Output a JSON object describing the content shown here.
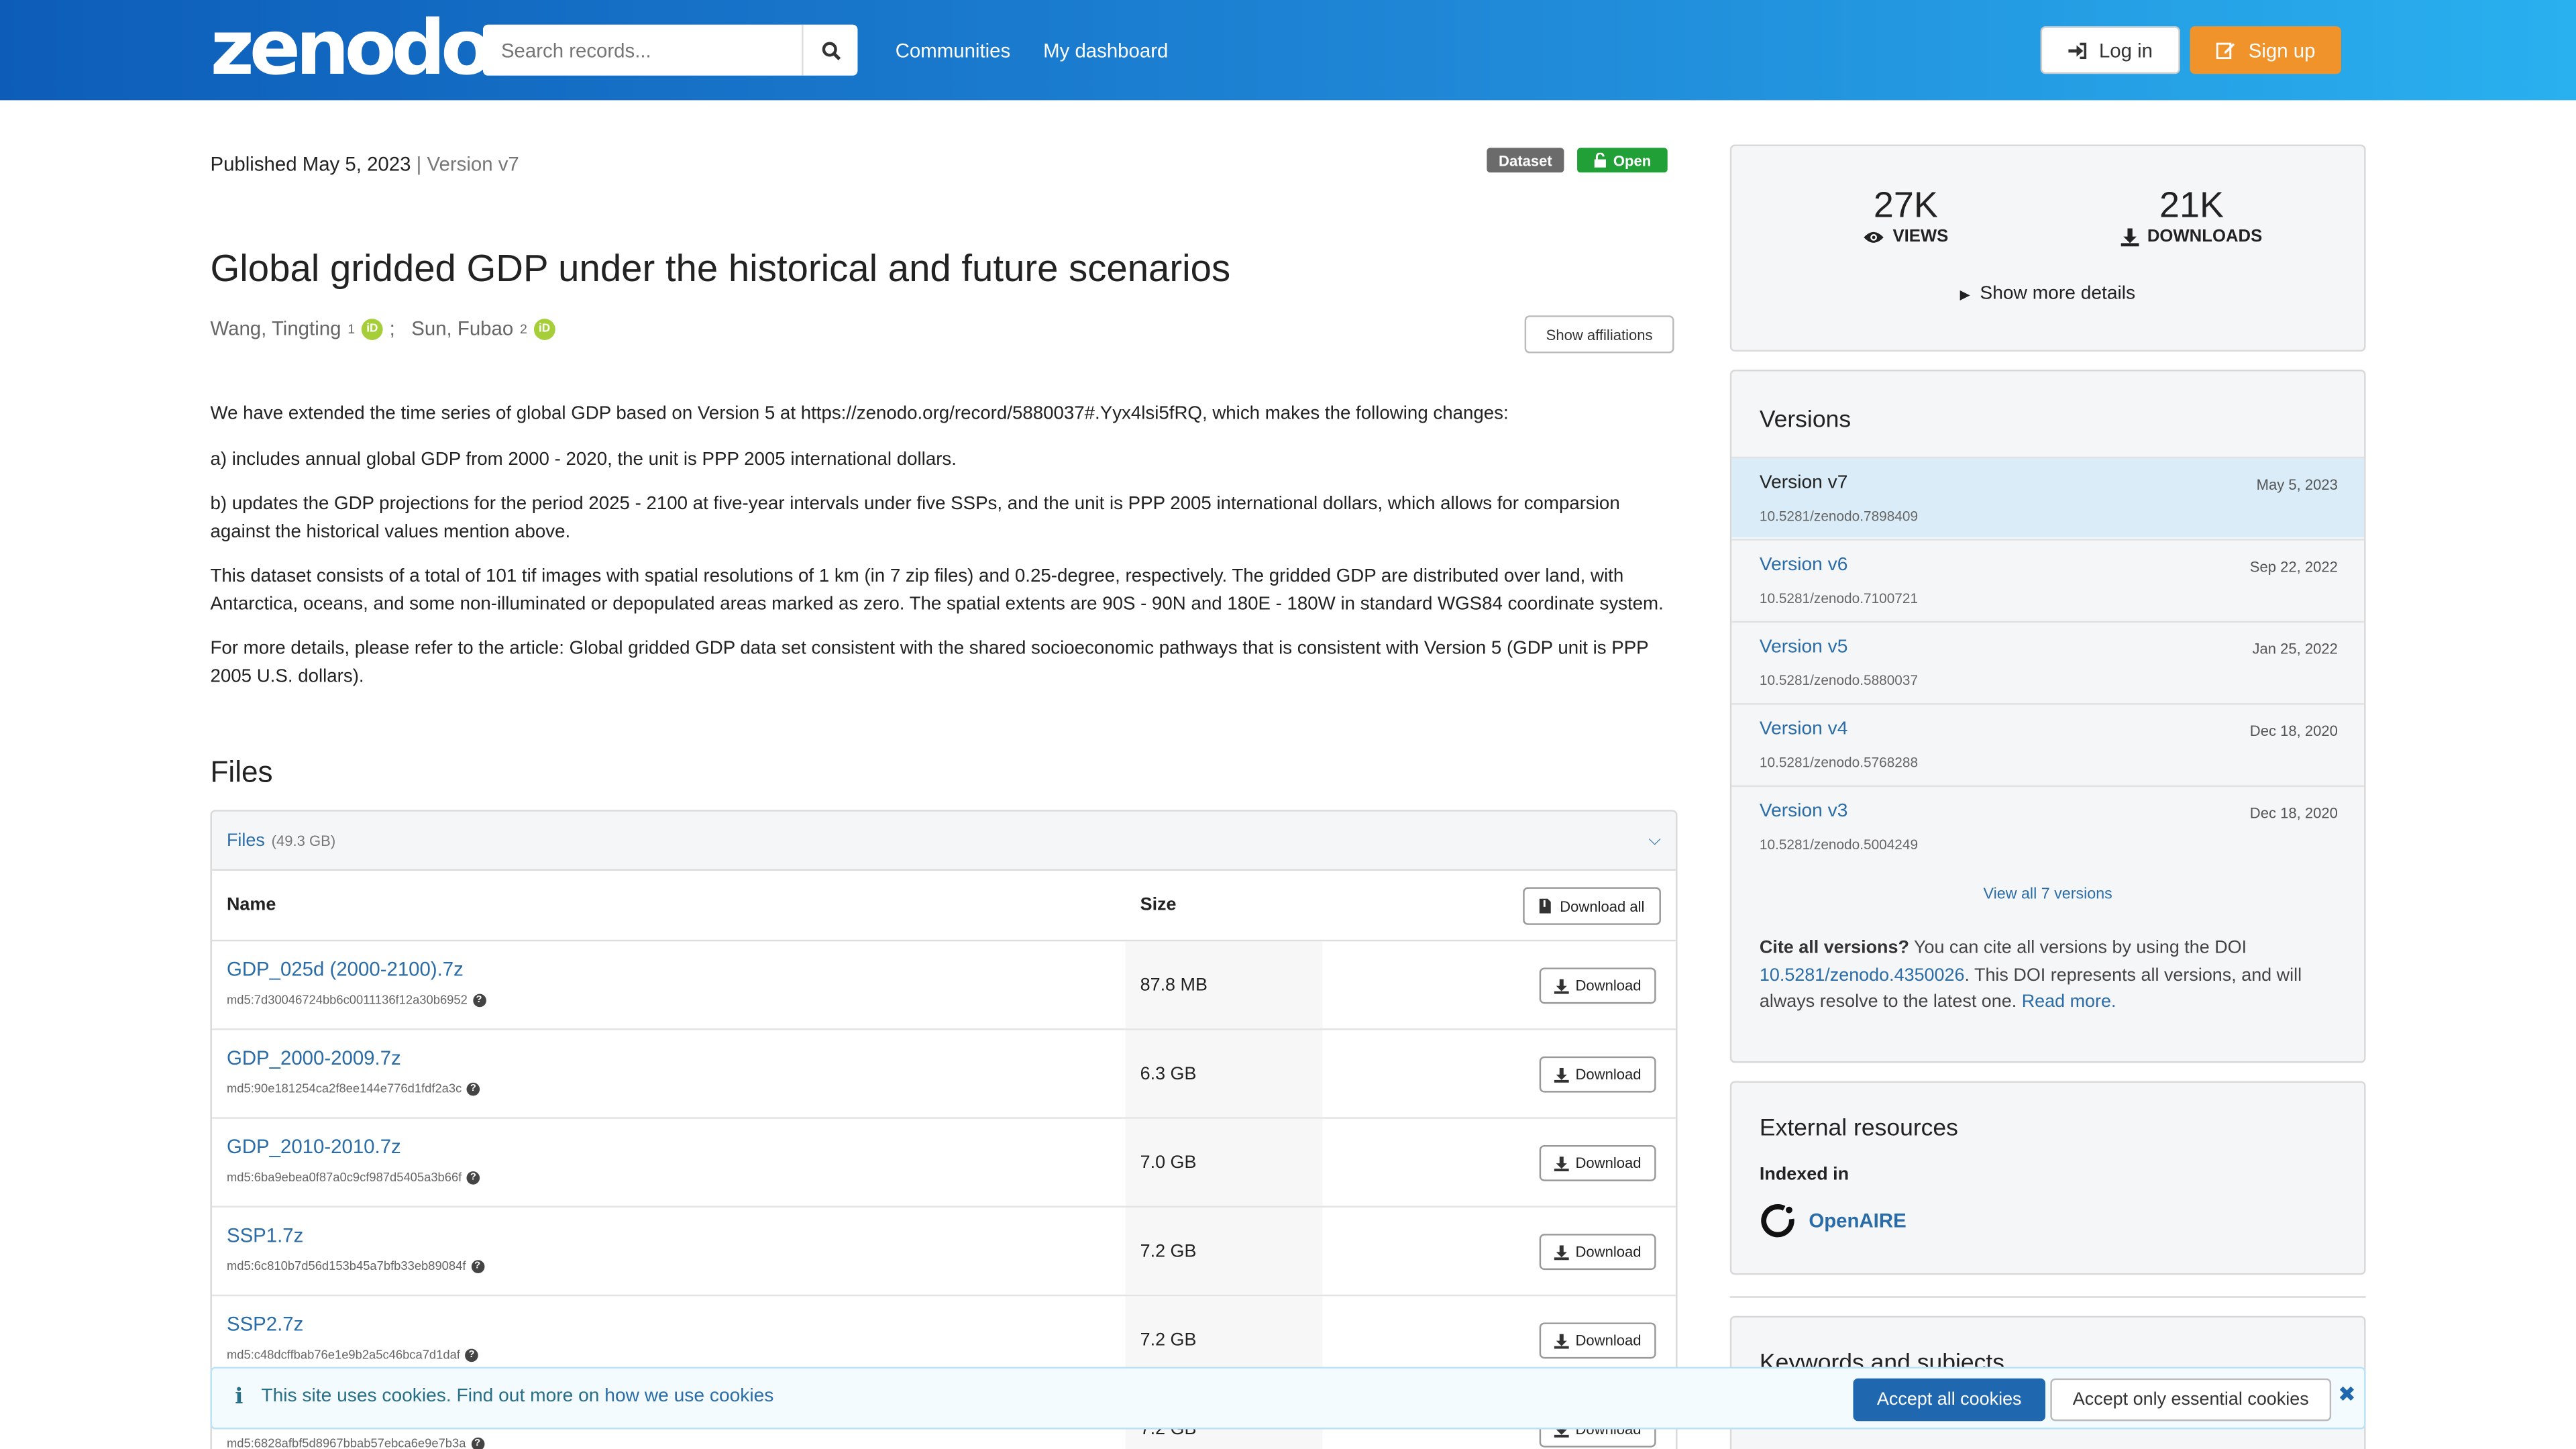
{
  "header": {
    "logo": "zenodo",
    "search_placeholder": "Search records...",
    "nav": [
      "Communities",
      "My dashboard"
    ],
    "login_label": "Log in",
    "signup_label": "Sign up"
  },
  "record": {
    "published": "Published May 5, 2023",
    "version_sep": "|",
    "version": "Version v7",
    "badges": {
      "type": "Dataset",
      "access": "Open"
    },
    "title": "Global gridded GDP under the historical and future scenarios",
    "authors": [
      {
        "name": "Wang, Tingting",
        "sup": "1",
        "sep": ";"
      },
      {
        "name": "Sun, Fubao",
        "sup": "2",
        "sep": ""
      }
    ],
    "show_affiliations": "Show affiliations",
    "description": [
      "We have extended the time series of global GDP based on Version 5 at https://zenodo.org/record/5880037#.Yyx4lsi5fRQ, which makes the following changes:",
      "a) includes annual global GDP from 2000 - 2020, the unit is PPP 2005 international dollars.",
      "b) updates the GDP projections for the period 2025 - 2100 at five-year intervals under five SSPs, and the unit is PPP 2005 international dollars, which allows for comparsion against the historical values mention above.",
      "This dataset consists of a total of 101 tif images with spatial resolutions of 1 km (in 7 zip files) and 0.25-degree, respectively. The gridded GDP are distributed over land, with Antarctica, oceans, and some non-illuminated or depopulated areas marked as zero. The spatial extents are 90S - 90N and 180E - 180W in standard WGS84 coordinate system.",
      "For more details, please refer to the article: Global gridded GDP data set consistent with the shared socioeconomic pathways that is consistent with Version 5 (GDP unit is PPP 2005 U.S. dollars)."
    ]
  },
  "files": {
    "heading": "Files",
    "panel_label": "Files",
    "total_size": "(49.3 GB)",
    "col_name": "Name",
    "col_size": "Size",
    "download_all": "Download all",
    "download_label": "Download",
    "rows": [
      {
        "name": "GDP_025d (2000-2100).7z",
        "md5": "md5:7d30046724bb6c0011136f12a30b6952",
        "size": "87.8 MB"
      },
      {
        "name": "GDP_2000-2009.7z",
        "md5": "md5:90e181254ca2f8ee144e776d1fdf2a3c",
        "size": "6.3 GB"
      },
      {
        "name": "GDP_2010-2010.7z",
        "md5": "md5:6ba9ebea0f87a0c9cf987d5405a3b66f",
        "size": "7.0 GB"
      },
      {
        "name": "SSP1.7z",
        "md5": "md5:6c810b7d56d153b45a7bfb33eb89084f",
        "size": "7.2 GB"
      },
      {
        "name": "SSP2.7z",
        "md5": "md5:c48dcffbab76e1e9b2a5c46bca7d1daf",
        "size": "7.2 GB"
      },
      {
        "name": "",
        "md5": "md5:6828afbf5d8967bbab57ebca6e9e7b3a",
        "size": "7.2 GB"
      }
    ]
  },
  "stats": {
    "views": "27K",
    "views_label": "VIEWS",
    "downloads": "21K",
    "downloads_label": "DOWNLOADS",
    "more_details": "Show more details"
  },
  "versions": {
    "heading": "Versions",
    "items": [
      {
        "label": "Version v7",
        "date": "May 5, 2023",
        "doi": "10.5281/zenodo.7898409"
      },
      {
        "label": "Version v6",
        "date": "Sep 22, 2022",
        "doi": "10.5281/zenodo.7100721"
      },
      {
        "label": "Version v5",
        "date": "Jan 25, 2022",
        "doi": "10.5281/zenodo.5880037"
      },
      {
        "label": "Version v4",
        "date": "Dec 18, 2020",
        "doi": "10.5281/zenodo.5768288"
      },
      {
        "label": "Version v3",
        "date": "Dec 18, 2020",
        "doi": "10.5281/zenodo.5004249"
      }
    ],
    "view_all": "View all 7 versions",
    "cite_bold": "Cite all versions?",
    "cite_text1": "You can cite all versions by using the DOI",
    "cite_doi": "10.5281/zenodo.4350026",
    "cite_text2": ". This DOI represents all versions, and will always resolve to the latest one.",
    "read_more": "Read more."
  },
  "external": {
    "heading": "External resources",
    "indexed_in": "Indexed in",
    "openaire": "OpenAIRE"
  },
  "keywords": {
    "heading": "Keywords and subjects"
  },
  "cookie": {
    "message": "This site uses cookies. Find out more on",
    "link": "how we use cookies",
    "accept_all": "Accept all cookies",
    "accept_essential": "Accept only essential cookies"
  },
  "colors": {
    "header_start": "#0d5db8",
    "header_end": "#29b0ef",
    "link": "#2a6ca8",
    "signup": "#f0932b",
    "open_badge": "#21a038",
    "dataset_badge": "#6b6b6b"
  }
}
